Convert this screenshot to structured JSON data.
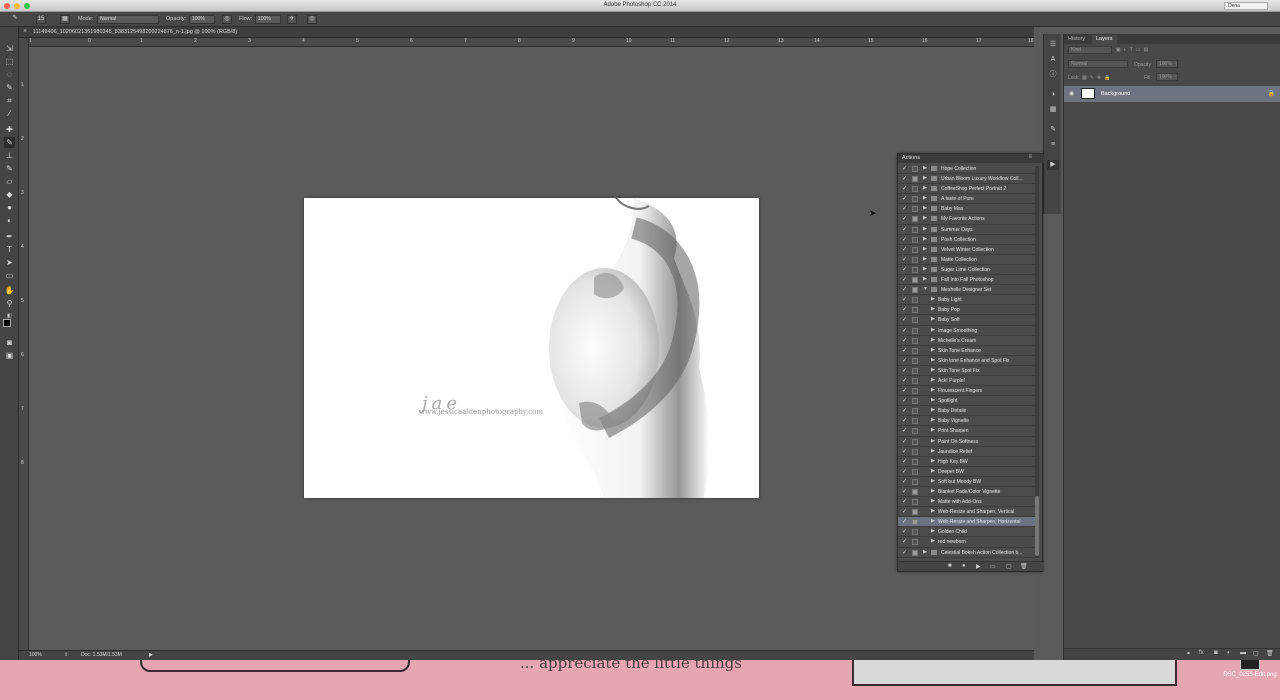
{
  "app": {
    "title": "Adobe Photoshop CC 2014",
    "user": "Dena"
  },
  "options_bar": {
    "brush_size": "15",
    "mode_label": "Mode:",
    "mode_value": "Normal",
    "opacity_label": "Opacity:",
    "opacity_value": "100%",
    "flow_label": "Flow:",
    "flow_value": "100%"
  },
  "document": {
    "tab_label": "11149406_10206021361980345_8383125498200224876_n-1.jpg @ 100% (RGB/8)",
    "watermark_script": "jae",
    "watermark_url": "www.jessicaaldenphotography.com"
  },
  "ruler": {
    "h_labels": [
      "1",
      "0",
      "1",
      "2",
      "3",
      "4",
      "5",
      "6",
      "7",
      "8",
      "9",
      "10",
      "11",
      "12",
      "13",
      "14",
      "15",
      "16",
      "17",
      "18"
    ],
    "v_labels": [
      "1",
      "2",
      "3",
      "4",
      "5",
      "6",
      "7",
      "8"
    ]
  },
  "status": {
    "zoom": "100%",
    "doc_size": "Doc: 1.53M/1.53M"
  },
  "layers_panel": {
    "tabs": [
      "History",
      "Layers"
    ],
    "active_tab": "Layers",
    "kind_filter": "Kind",
    "blend_mode": "Normal",
    "opacity_label": "Opacity:",
    "opacity_value": "100%",
    "lock_label": "Lock:",
    "fill_label": "Fill:",
    "fill_value": "100%",
    "layer_name": "Background"
  },
  "actions_panel": {
    "title": "Actions",
    "items": [
      {
        "label": "Hope Collection",
        "level": 0,
        "folder": true,
        "dialog": false
      },
      {
        "label": "Urban Bloom Luxury Workflow Coll...",
        "level": 0,
        "folder": true,
        "dialog": true
      },
      {
        "label": "CoffeeShop Perfect Portrait 2",
        "level": 0,
        "folder": true,
        "dialog": false
      },
      {
        "label": "A taste of Pure",
        "level": 0,
        "folder": true,
        "dialog": false
      },
      {
        "label": "Baby Max",
        "level": 0,
        "folder": true,
        "dialog": false
      },
      {
        "label": "My Favorite Actions",
        "level": 0,
        "folder": true,
        "dialog": true
      },
      {
        "label": "Summer Days",
        "level": 0,
        "folder": true,
        "dialog": false
      },
      {
        "label": "Posh Collection",
        "level": 0,
        "folder": true,
        "dialog": false
      },
      {
        "label": "Velvet Winter Collection",
        "level": 0,
        "folder": true,
        "dialog": false
      },
      {
        "label": "Matte Collection",
        "level": 0,
        "folder": true,
        "dialog": false
      },
      {
        "label": "Sugar Lime Collection",
        "level": 0,
        "folder": true,
        "dialog": false
      },
      {
        "label": "Fall Into Fall Photoshop",
        "level": 0,
        "folder": true,
        "dialog": true
      },
      {
        "label": "Meshelle Designer Set",
        "level": 0,
        "folder": true,
        "dialog": true,
        "open": true
      },
      {
        "label": "Baby Light",
        "level": 1
      },
      {
        "label": "Baby Pop",
        "level": 1
      },
      {
        "label": "Baby Soft",
        "level": 1
      },
      {
        "label": "Image Smoothing",
        "level": 1
      },
      {
        "label": "Michelle's Cream",
        "level": 1
      },
      {
        "label": "Skin Tone Enhance",
        "level": 1
      },
      {
        "label": "Skin tone Enhance and Spot Fix",
        "level": 1
      },
      {
        "label": "Skin Tone Spot Fix",
        "level": 1
      },
      {
        "label": "Ack! Purple!",
        "level": 1
      },
      {
        "label": "Flourescent Fingers",
        "level": 1
      },
      {
        "label": "Spotlight",
        "level": 1
      },
      {
        "label": "Baby Details",
        "level": 1
      },
      {
        "label": "Baby Vignette",
        "level": 1
      },
      {
        "label": "Print Sharpen",
        "level": 1
      },
      {
        "label": "Paint On Softness",
        "level": 1
      },
      {
        "label": "Jaundice Relief",
        "level": 1
      },
      {
        "label": "High Key BW",
        "level": 1
      },
      {
        "label": "Deeper BW",
        "level": 1
      },
      {
        "label": "Soft but Moody BW",
        "level": 1
      },
      {
        "label": "Blanket Fade/Color Vignette",
        "level": 1,
        "dialog": true
      },
      {
        "label": "Matte with Add-Ons",
        "level": 1
      },
      {
        "label": "Web-Resize and Sharpen, Vertical",
        "level": 1,
        "dialog": true
      },
      {
        "label": "Web-Resize and Sharpen, Horizontal",
        "level": 1,
        "dialog": true,
        "selected": true
      },
      {
        "label": "Golden Child",
        "level": 1
      },
      {
        "label": "red newborn",
        "level": 1
      },
      {
        "label": "Celestial Bokeh Action Collection b...",
        "level": 0,
        "folder": true,
        "dialog": true
      }
    ]
  },
  "desktop": {
    "text": "... appreciate the little things",
    "file_name": "DSC_0253-Edit.png"
  },
  "colors": {
    "panel_bg": "#484848",
    "canvas_bg": "#5b5b5b",
    "selection": "#6b7083",
    "desktop_pink": "#e5a6b2"
  }
}
